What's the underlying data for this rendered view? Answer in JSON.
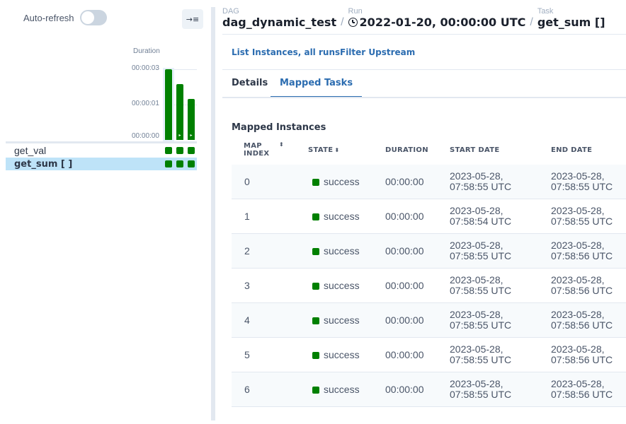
{
  "left": {
    "autorefresh_label": "Auto-refresh",
    "collapse_icon": "→≡",
    "duration_label": "Duration",
    "ticks": [
      "00:00:03",
      "00:00:01",
      "00:00:00"
    ],
    "tasks": [
      {
        "name": "get_val"
      },
      {
        "name": "get_sum [ ]"
      }
    ],
    "bar_play_icon": "▸"
  },
  "header": {
    "dag_label": "DAG",
    "dag_value": "dag_dynamic_test",
    "run_label": "Run",
    "run_value": "2022-01-20, 00:00:00 UTC",
    "task_label": "Task",
    "task_value": "get_sum []",
    "sep": "/"
  },
  "actions": {
    "list_instances": "List Instances, all runs",
    "filter_upstream": "Filter Upstream"
  },
  "tabs": {
    "details": "Details",
    "mapped": "Mapped Tasks"
  },
  "table": {
    "title": "Mapped Instances",
    "headers": {
      "map_index_1": "MAP",
      "map_index_2": "INDEX",
      "state": "STATE",
      "duration": "DURATION",
      "start": "START DATE",
      "end": "END DATE"
    },
    "sort_icon": "⬍",
    "rows": [
      {
        "index": "0",
        "state": "success",
        "duration": "00:00:00",
        "start_1": "2023-05-28,",
        "start_2": "07:58:55 UTC",
        "end_1": "2023-05-28,",
        "end_2": "07:58:55 UTC"
      },
      {
        "index": "1",
        "state": "success",
        "duration": "00:00:00",
        "start_1": "2023-05-28,",
        "start_2": "07:58:54 UTC",
        "end_1": "2023-05-28,",
        "end_2": "07:58:55 UTC"
      },
      {
        "index": "2",
        "state": "success",
        "duration": "00:00:00",
        "start_1": "2023-05-28,",
        "start_2": "07:58:55 UTC",
        "end_1": "2023-05-28,",
        "end_2": "07:58:56 UTC"
      },
      {
        "index": "3",
        "state": "success",
        "duration": "00:00:00",
        "start_1": "2023-05-28,",
        "start_2": "07:58:55 UTC",
        "end_1": "2023-05-28,",
        "end_2": "07:58:56 UTC"
      },
      {
        "index": "4",
        "state": "success",
        "duration": "00:00:00",
        "start_1": "2023-05-28,",
        "start_2": "07:58:55 UTC",
        "end_1": "2023-05-28,",
        "end_2": "07:58:56 UTC"
      },
      {
        "index": "5",
        "state": "success",
        "duration": "00:00:00",
        "start_1": "2023-05-28,",
        "start_2": "07:58:55 UTC",
        "end_1": "2023-05-28,",
        "end_2": "07:58:56 UTC"
      },
      {
        "index": "6",
        "state": "success",
        "duration": "00:00:00",
        "start_1": "2023-05-28,",
        "start_2": "07:58:55 UTC",
        "end_1": "2023-05-28,",
        "end_2": "07:58:56 UTC"
      }
    ]
  },
  "colors": {
    "success": "#008000",
    "link": "#2b6cb0",
    "selected_row": "#bee3f8"
  }
}
